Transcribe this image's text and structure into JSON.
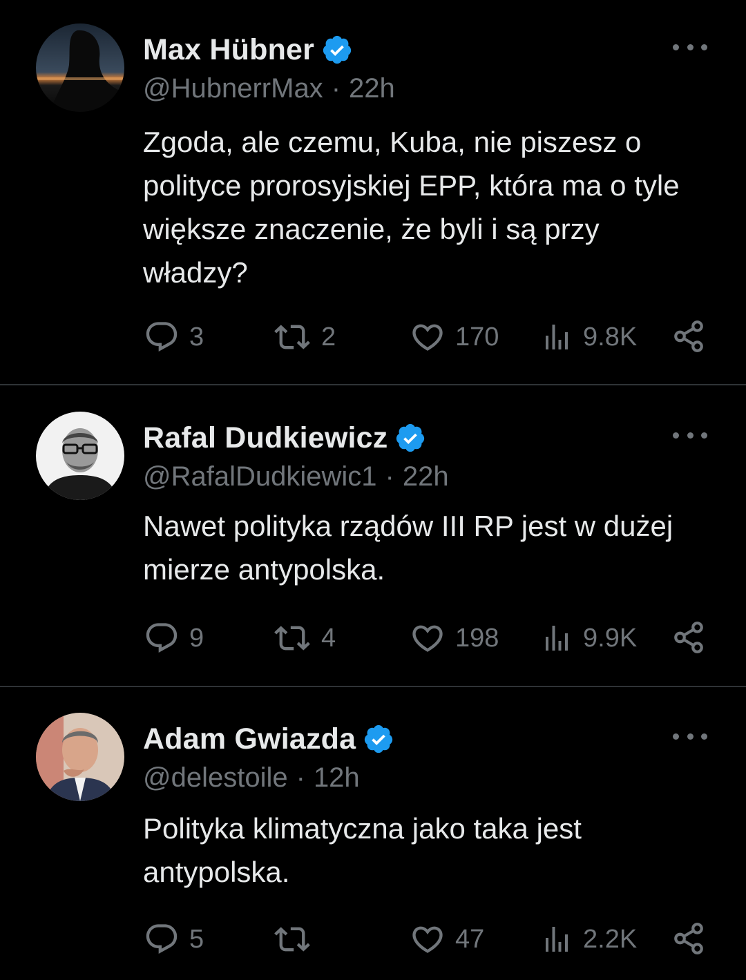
{
  "tweets": [
    {
      "name": "Max Hübner",
      "handle": "@HubnerrMax",
      "separator": "·",
      "time": "22h",
      "verified": true,
      "text": "Zgoda, ale czemu, Kuba, nie piszesz o polityce prorosyjskiej EPP, która ma o tyle większe znaczenie, że byli i są przy władzy?",
      "replies": "3",
      "reposts": "2",
      "likes": "170",
      "views": "9.8K"
    },
    {
      "name": "Rafal Dudkiewicz",
      "handle": "@RafalDudkiewic1",
      "separator": "·",
      "time": "22h",
      "verified": true,
      "text": "Nawet polityka rządów III RP jest w dużej mierze antypolska.",
      "replies": "9",
      "reposts": "4",
      "likes": "198",
      "views": "9.9K"
    },
    {
      "name": "Adam Gwiazda",
      "handle": "@delestoile",
      "separator": "·",
      "time": "12h",
      "verified": true,
      "text": "Polityka klimatyczna jako taka jest antypolska.",
      "replies": "5",
      "reposts": "",
      "likes": "47",
      "views": "2.2K"
    }
  ],
  "colors": {
    "background": "#000000",
    "text": "#e7e9ea",
    "muted": "#71767b",
    "verified_blue": "#1d9bf0",
    "divider": "#2f3336"
  },
  "icons": [
    "reply-icon",
    "repost-icon",
    "like-icon",
    "views-icon",
    "share-icon",
    "more-icon",
    "verified-badge-icon"
  ]
}
